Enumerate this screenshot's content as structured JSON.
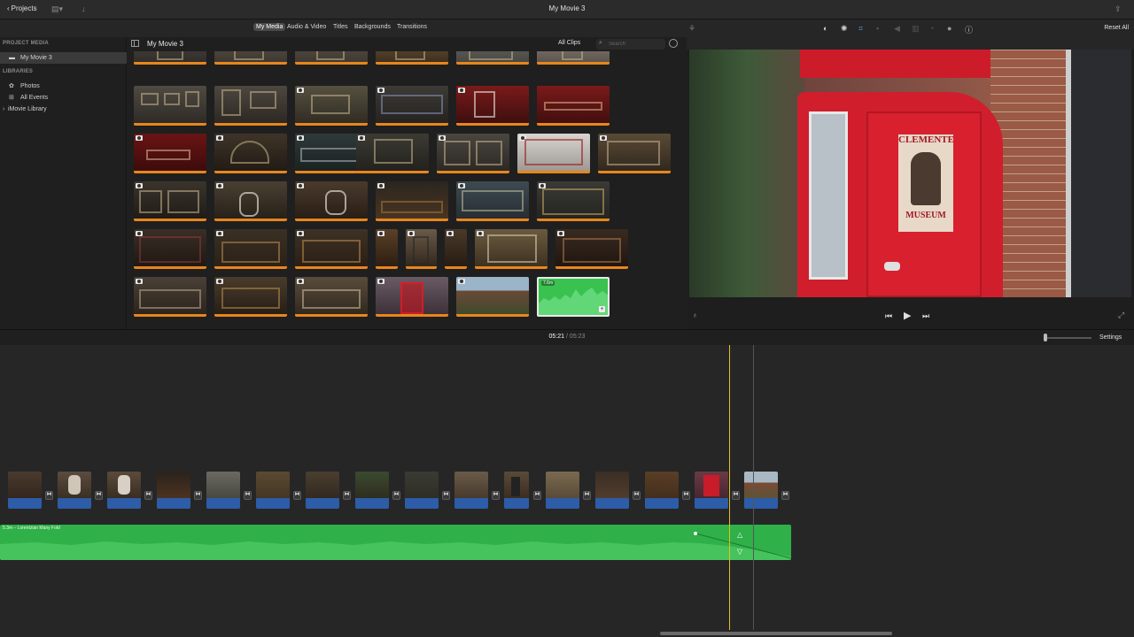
{
  "topbar": {
    "projects_label": "Projects",
    "title": "My Movie 3"
  },
  "tabs": [
    {
      "label": "My Media",
      "active": true
    },
    {
      "label": "Audio & Video",
      "active": false
    },
    {
      "label": "Titles",
      "active": false
    },
    {
      "label": "Backgrounds",
      "active": false
    },
    {
      "label": "Transitions",
      "active": false
    }
  ],
  "sidebar": {
    "project_header": "PROJECT MEDIA",
    "project_item": "My Movie 3",
    "libraries_header": "LIBRARIES",
    "items": [
      {
        "label": "Photos",
        "icon": "photos-icon"
      },
      {
        "label": "All Events",
        "icon": "all-events-icon"
      },
      {
        "label": "iMovie Library",
        "icon": "chevron-right-icon"
      }
    ]
  },
  "browser": {
    "title": "My Movie 3",
    "filter_label": "All Clips",
    "search_placeholder": "Search"
  },
  "music_clip": {
    "duration": "7.6m"
  },
  "viewer": {
    "reset_label": "Reset All",
    "door_text_top": "CLEMENTE",
    "door_text_bottom": "MUSEUM"
  },
  "timeline": {
    "current_time": "05:21",
    "separator": "/",
    "total_time": "05:23",
    "settings_label": "Settings",
    "audio_label": "5.3m – Lorentzian Many Fold"
  },
  "colors": {
    "accent_orange": "#e8861c",
    "audio_green": "#2fb048",
    "video_blue": "#2d5ca8",
    "playhead": "#e0c020"
  }
}
